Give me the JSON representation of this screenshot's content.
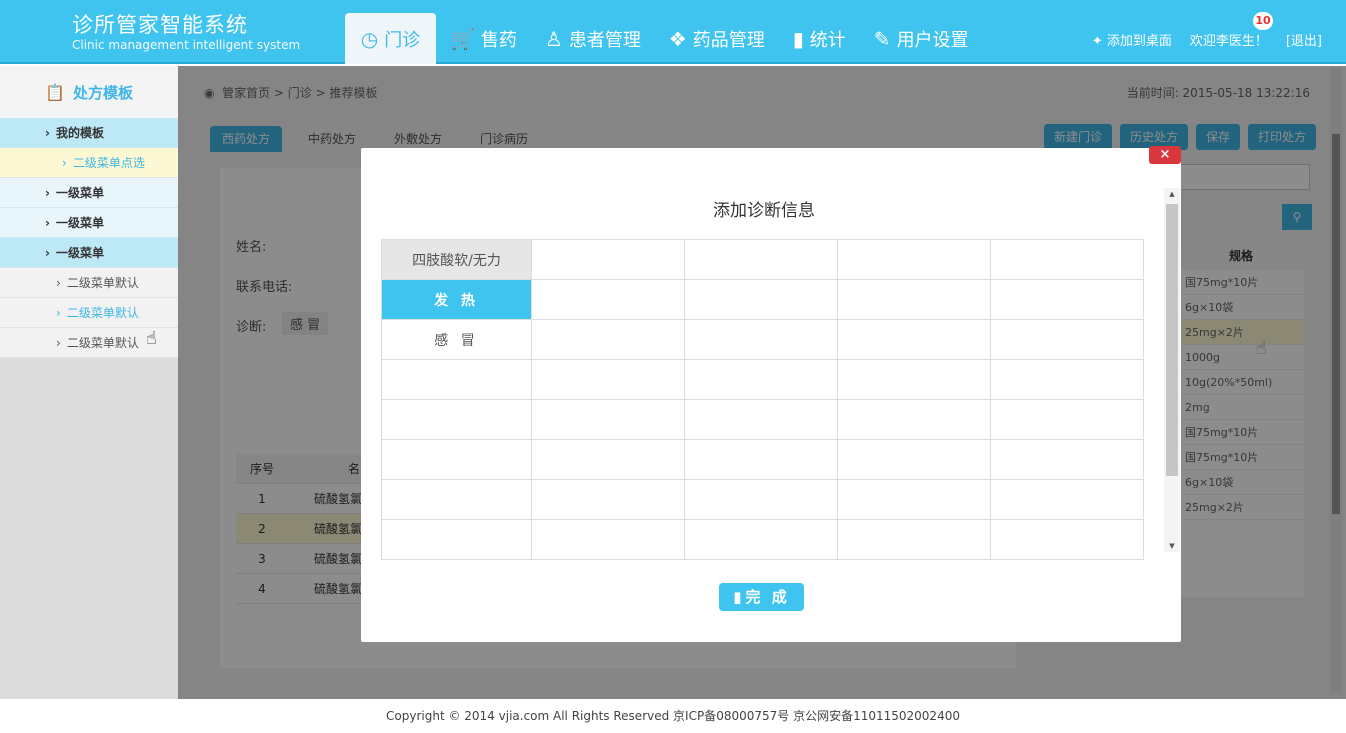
{
  "header": {
    "app_title_cn": "诊所管家智能系统",
    "app_title_en": "Clinic management intelligent system",
    "nav": [
      {
        "label": "门诊",
        "icon": "clock-icon",
        "glyph": "◷"
      },
      {
        "label": "售药",
        "icon": "cart-icon",
        "glyph": "🛒"
      },
      {
        "label": "患者管理",
        "icon": "person-icon",
        "glyph": "♙"
      },
      {
        "label": "药品管理",
        "icon": "pill-icon",
        "glyph": "💊"
      },
      {
        "label": "统计",
        "icon": "bar-chart-icon",
        "glyph": "▮"
      },
      {
        "label": "用户设置",
        "icon": "pencil-icon",
        "glyph": "✎"
      }
    ],
    "add_to_desktop": "添加到桌面",
    "welcome": "欢迎李医生！",
    "notification_count": "10",
    "logout": "[退出]"
  },
  "sidebar": {
    "title": "处方模板",
    "items": [
      {
        "label": "我的模板",
        "level": 1,
        "state": "open"
      },
      {
        "label": "二级菜单点选",
        "level": 2,
        "state": "selected"
      },
      {
        "label": "一级菜单",
        "level": 1,
        "state": "plain"
      },
      {
        "label": "一级菜单",
        "level": 1,
        "state": "plain"
      },
      {
        "label": "一级菜单",
        "level": 1,
        "state": "open"
      },
      {
        "label": "二级菜单默认",
        "level": 2,
        "state": "default"
      },
      {
        "label": "二级菜单默认",
        "level": 2,
        "state": "hover"
      },
      {
        "label": "二级菜单默认",
        "level": 2,
        "state": "default"
      }
    ]
  },
  "main": {
    "breadcrumb": "管家首页 > 门诊 > 推荐模板",
    "current_time": "当前时间: 2015-05-18  13:22:16",
    "tabs": [
      "西药处方",
      "中药处方",
      "外敷处方",
      "门诊病历"
    ],
    "toolbar": [
      "新建门诊",
      "历史处方",
      "保存",
      "打印处方"
    ],
    "name_label": "姓名:",
    "phone_label": "联系电话:",
    "diagnosis_label": "诊断:",
    "diagnosis_tag": "感 冒",
    "table_header_no": "序号",
    "table_header_name": "名",
    "table_rows": [
      {
        "no": "1",
        "name": "硫酸氢氯"
      },
      {
        "no": "2",
        "name": "硫酸氢氯"
      },
      {
        "no": "3",
        "name": "硫酸氢氯"
      },
      {
        "no": "4",
        "name": "硫酸氢氯"
      }
    ],
    "spec_header": "规格",
    "spec_rows": [
      "国75mg*10片",
      "6g×10袋",
      "25mg×2片",
      "1000g",
      "10g(20%*50ml)",
      "2mg",
      "国75mg*10片",
      "国75mg*10片",
      "6g×10袋",
      "25mg×2片"
    ]
  },
  "modal": {
    "close": "×",
    "title": "添加诊断信息",
    "categories": [
      "四肢酸软/无力",
      "发 热",
      "感 冒",
      "",
      "",
      "",
      "",
      ""
    ],
    "finish_button": "完 成"
  },
  "footer": {
    "copyright": "Copyright © 2014 vjia.com All Rights Reserved 京ICP备08000757号 京公网安备11011502002400"
  },
  "colors": {
    "accent": "#3fc3ef",
    "close_red": "#d9363e",
    "selected_bg": "#fdf8d4"
  }
}
